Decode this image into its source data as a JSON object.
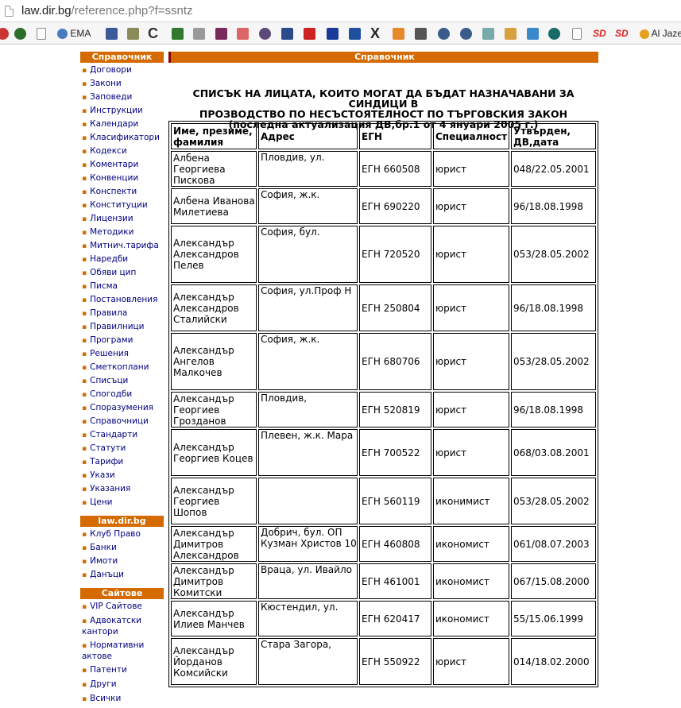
{
  "browser": {
    "url_host": "law.dir.bg",
    "url_path": "/reference.php?f=ssntz"
  },
  "bookmarks": {
    "items": [
      "EMA",
      "SD",
      "SD",
      "Al Jaze"
    ]
  },
  "sidebar": {
    "header1": "Справочник",
    "items1": [
      "Договори",
      "Закони",
      "Заповеди",
      "Инструкции",
      "Календари",
      "Класификатори",
      "Кодекси",
      "Коментари",
      "Конвенции",
      "Конспекти",
      "Конституции",
      "Лицензии",
      "Методики",
      "Митнич.тарифа",
      "Наредби",
      "Обяви цип",
      "Писма",
      "Постановления",
      "Правила",
      "Правилници",
      "Програми",
      "Решения",
      "Сметкоплани",
      "Списъци",
      "Спогодби",
      "Споразумения",
      "Справочници",
      "Стандарти",
      "Статути",
      "Тарифи",
      "Укази",
      "Указания",
      "Цени"
    ],
    "header2": "law.dir.bg",
    "items2": [
      "Клуб Право",
      "Банки",
      "Имоти",
      "Данъци"
    ],
    "header3": "Сайтове",
    "items3": [
      "VIP Сайтове",
      "Адвокатски кантори",
      "Нормативни актове",
      "Патенти",
      "Други",
      "Всички"
    ]
  },
  "main": {
    "header": "Справочник",
    "title_line1": "СПИСЪК НА ЛИЦАТА, КОИТО МОГАТ ДА БЪДАТ НАЗНАЧАВАНИ ЗА СИНДИЦИ В",
    "title_line2": "ПРОЗВОДСТВО ПО НЕСЪСТОЯТЕЛНОСТ ПО ТЪРГОВСКИЯ ЗАКОН",
    "title_line3": "(последна актуализация ДВ,бр.1 от 4 януари 2005 г.)",
    "columns": [
      "Име, презиме, фамилия",
      "Адрес",
      "ЕГН",
      "Специалност",
      "Утвърден, ДВ,дата"
    ],
    "rows": [
      {
        "name": "Албена Георгиева Пискова",
        "addr": "Пловдив, ул.",
        "egn": "ЕГН 660508",
        "spec": "юрист",
        "date": "048/22.05.2001"
      },
      {
        "name": "Албена Иванова Милетиева",
        "addr": "София, ж.к.",
        "egn": "ЕГН 690220",
        "spec": "юрист",
        "date": "96/18.08.1998"
      },
      {
        "name": "Александър Александров Пелев",
        "addr": "София, бул.",
        "egn": "ЕГН 720520",
        "spec": "юрист",
        "date": "053/28.05.2002"
      },
      {
        "name": "Александър Александров Сталийски",
        "addr": "София, ул.Проф Н",
        "egn": "ЕГН 250804",
        "spec": "юрист",
        "date": "96/18.08.1998"
      },
      {
        "name": "Александър Ангелов Малкочев",
        "addr": "София, ж.к.",
        "egn": "ЕГН 680706",
        "spec": "юрист",
        "date": "053/28.05.2002"
      },
      {
        "name": "Александър Георгиев Гроздaнов",
        "addr": "Пловдив,",
        "egn": "ЕГН 520819",
        "spec": "юрист",
        "date": "96/18.08.1998"
      },
      {
        "name": "Александър Георгиев Коцев",
        "addr": "Плевен, ж.к. Мара",
        "egn": "ЕГН 700522",
        "spec": "юрист",
        "date": "068/03.08.2001"
      },
      {
        "name": "Александър Георгиев Шопов",
        "addr": "",
        "egn": "ЕГН 560119",
        "spec": "иконимист",
        "date": "053/28.05.2002"
      },
      {
        "name": "Александър Димитров Александров",
        "addr": "Добрич, бул. ОП Кузман Христов 10",
        "egn": "ЕГН 460808",
        "spec": "икономист",
        "date": "061/08.07.2003"
      },
      {
        "name": "Александър Димитров Комитски",
        "addr": "Враца, ул. Ивайло",
        "egn": "ЕГН 461001",
        "spec": "икономист",
        "date": "067/15.08.2000"
      },
      {
        "name": "Александър Илиев Манчев",
        "addr": "Кюстендил, ул.",
        "egn": "ЕГН 620417",
        "spec": "икономист",
        "date": "55/15.06.1999"
      },
      {
        "name": "Александър Йорданов Комсийски",
        "addr": "Стара Загора,",
        "egn": "ЕГН 550922",
        "spec": "юрист",
        "date": "014/18.02.2000"
      }
    ]
  },
  "colors": {
    "accent": "#d46a00",
    "link": "#000080"
  }
}
